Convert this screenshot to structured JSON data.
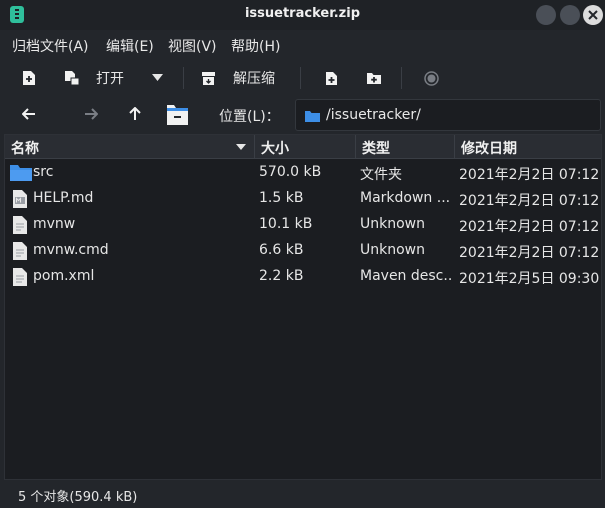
{
  "window": {
    "title": "issuetracker.zip"
  },
  "menu": {
    "items": [
      "归档文件(A)",
      "编辑(E)",
      "视图(V)",
      "帮助(H)"
    ]
  },
  "toolbar": {
    "open_label": "打开",
    "extract_label": "解压缩"
  },
  "location": {
    "label": "位置(L)：",
    "path": "/issuetracker/"
  },
  "table": {
    "columns": [
      "名称",
      "大小",
      "类型",
      "修改日期"
    ],
    "rows": [
      {
        "name": "src",
        "size": "570.0 kB",
        "type": "文件夹",
        "modified": "2021年2月2日 07:12",
        "icon": "folder-icon"
      },
      {
        "name": "HELP.md",
        "size": "1.5 kB",
        "type": "Markdown ...",
        "modified": "2021年2月2日 07:12",
        "icon": "markdown-file-icon"
      },
      {
        "name": "mvnw",
        "size": "10.1 kB",
        "type": "Unknown",
        "modified": "2021年2月2日 07:12",
        "icon": "file-icon"
      },
      {
        "name": "mvnw.cmd",
        "size": "6.6 kB",
        "type": "Unknown",
        "modified": "2021年2月2日 07:12",
        "icon": "file-icon"
      },
      {
        "name": "pom.xml",
        "size": "2.2 kB",
        "type": "Maven desc...",
        "modified": "2021年2月5日 09:30",
        "icon": "xml-file-icon"
      }
    ]
  },
  "status": {
    "text": "5 个对象(590.4 kB)"
  },
  "colors": {
    "accent": "#3d8ee6",
    "background": "#1b1d21",
    "app_icon": "#2fbf9b"
  }
}
